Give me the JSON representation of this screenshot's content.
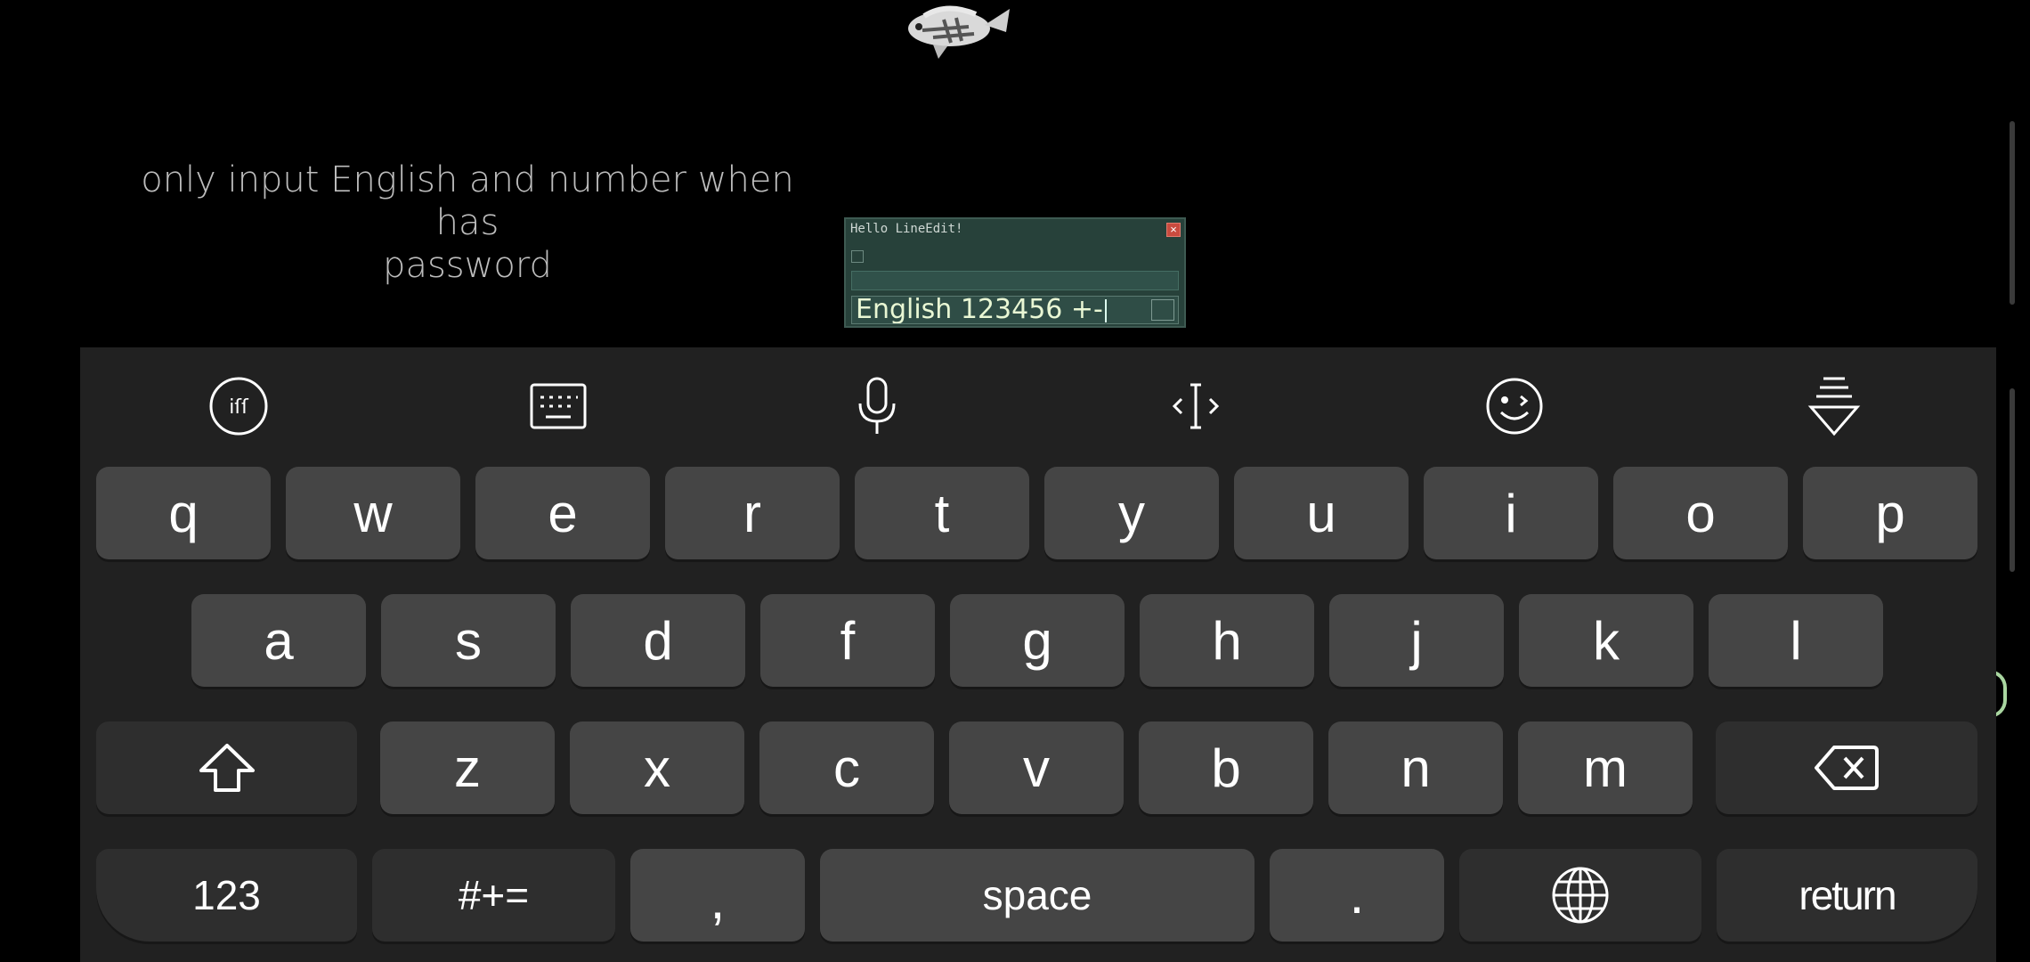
{
  "hint": {
    "line1": "only input English and number when has",
    "line2": "password"
  },
  "dialog": {
    "title": "Hello LineEdit!",
    "close_glyph": "×",
    "input_value": "English 123456 +-"
  },
  "toolbar": [
    "app-logo-icon",
    "keyboard-icon",
    "microphone-icon",
    "cursor-move-icon",
    "emoji-wink-icon",
    "hide-keyboard-icon"
  ],
  "keys": {
    "row1": [
      "q",
      "w",
      "e",
      "r",
      "t",
      "y",
      "u",
      "i",
      "o",
      "p"
    ],
    "row2": [
      "a",
      "s",
      "d",
      "f",
      "g",
      "h",
      "j",
      "k",
      "l"
    ],
    "row3": [
      "z",
      "x",
      "c",
      "v",
      "b",
      "n",
      "m"
    ],
    "num_label": "123",
    "symbols_label": "#+=",
    "comma_label": ",",
    "space_label": "space",
    "period_label": ".",
    "return_label": "return"
  }
}
